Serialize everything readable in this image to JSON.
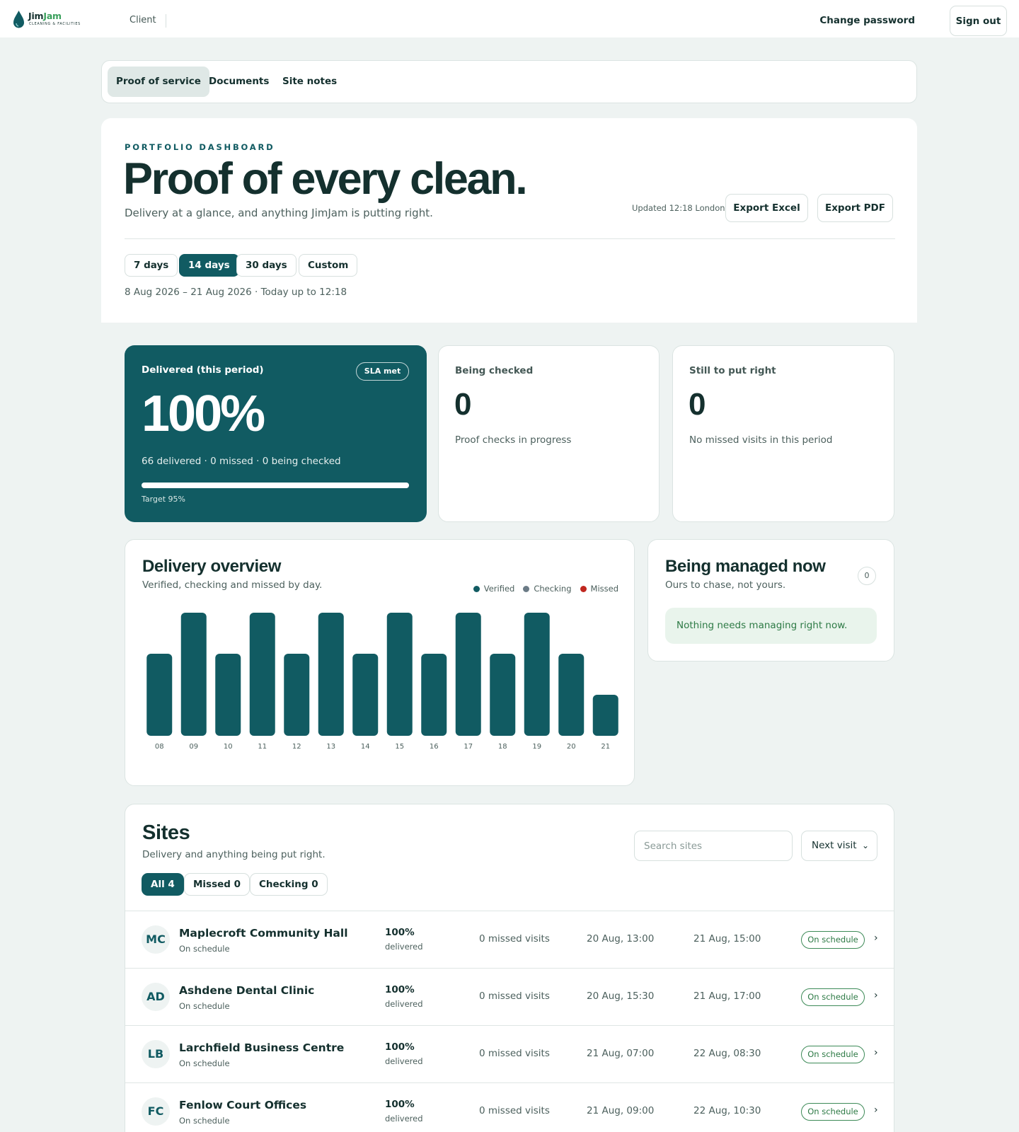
{
  "brand": {
    "name_a": "Jim",
    "name_b": "Jam",
    "tagline": "CLEANING & FACILITIES",
    "accent": "#115b62",
    "brand_green": "#3aa05c",
    "drop_icon": "water-drop-icon"
  },
  "topbar": {
    "section": "Client",
    "change_password": "Change password",
    "sign_out": "Sign out"
  },
  "tabs": [
    {
      "label": "Proof of service",
      "active": true
    },
    {
      "label": "Documents",
      "active": false
    },
    {
      "label": "Site notes",
      "active": false
    }
  ],
  "hero": {
    "eyebrow": "PORTFOLIO DASHBOARD",
    "title": "Proof of every clean.",
    "subtitle": "Delivery at a glance, and anything JimJam is putting right.",
    "updated": "Updated 12:18 London",
    "export_excel": "Export Excel",
    "export_pdf": "Export PDF",
    "periods": [
      "7 days",
      "14 days",
      "30 days",
      "Custom"
    ],
    "active_period": "14 days",
    "range": "8 Aug 2026 – 21 Aug 2026 · Today up to 12:18"
  },
  "kpis": {
    "delivered": {
      "label": "Delivered (this period)",
      "badge": "SLA met",
      "value": "100%",
      "sub": "66 delivered · 0 missed · 0 being checked",
      "target": "Target 95%",
      "progress": 1.0
    },
    "checking": {
      "label": "Being checked",
      "value": "0",
      "sub": "Proof checks in progress"
    },
    "put_right": {
      "label": "Still to put right",
      "value": "0",
      "sub": "No missed visits in this period"
    }
  },
  "overview": {
    "title": "Delivery overview",
    "subtitle": "Verified, checking and missed by day.",
    "legend": [
      {
        "label": "Verified",
        "color": "#115b62"
      },
      {
        "label": "Checking",
        "color": "#6b7b86"
      },
      {
        "label": "Missed",
        "color": "#c0271f"
      }
    ]
  },
  "chart_data": {
    "type": "bar",
    "categories": [
      "08",
      "09",
      "10",
      "11",
      "12",
      "13",
      "14",
      "15",
      "16",
      "17",
      "18",
      "19",
      "20",
      "21"
    ],
    "series": [
      {
        "name": "Verified",
        "values": [
          4,
          6,
          4,
          6,
          4,
          6,
          4,
          6,
          4,
          6,
          4,
          6,
          4,
          2
        ]
      },
      {
        "name": "Checking",
        "values": [
          0,
          0,
          0,
          0,
          0,
          0,
          0,
          0,
          0,
          0,
          0,
          0,
          0,
          0
        ]
      },
      {
        "name": "Missed",
        "values": [
          0,
          0,
          0,
          0,
          0,
          0,
          0,
          0,
          0,
          0,
          0,
          0,
          0,
          0
        ]
      }
    ],
    "ylim": [
      0,
      6
    ],
    "grid": false,
    "legend_position": "top-right"
  },
  "managed": {
    "title": "Being managed now",
    "subtitle": "Ours to chase, not yours.",
    "count": "0",
    "empty": "Nothing needs managing right now."
  },
  "sites": {
    "title": "Sites",
    "subtitle": "Delivery and anything being put right.",
    "search_placeholder": "Search sites",
    "sort": "Next visit",
    "filters": [
      {
        "label": "All 4",
        "active": true
      },
      {
        "label": "Missed 0",
        "active": false
      },
      {
        "label": "Checking 0",
        "active": false
      }
    ],
    "rows": [
      {
        "initials": "MC",
        "name": "Maplecroft Community Hall",
        "status": "On schedule",
        "pct": "100%",
        "pct_label": "delivered",
        "missed": "0 missed visits",
        "last": "20 Aug, 13:00",
        "next": "21 Aug, 15:00",
        "badge": "On schedule"
      },
      {
        "initials": "AD",
        "name": "Ashdene Dental Clinic",
        "status": "On schedule",
        "pct": "100%",
        "pct_label": "delivered",
        "missed": "0 missed visits",
        "last": "20 Aug, 15:30",
        "next": "21 Aug, 17:00",
        "badge": "On schedule"
      },
      {
        "initials": "LB",
        "name": "Larchfield Business Centre",
        "status": "On schedule",
        "pct": "100%",
        "pct_label": "delivered",
        "missed": "0 missed visits",
        "last": "21 Aug, 07:00",
        "next": "22 Aug, 08:30",
        "badge": "On schedule"
      },
      {
        "initials": "FC",
        "name": "Fenlow Court Offices",
        "status": "On schedule",
        "pct": "100%",
        "pct_label": "delivered",
        "missed": "0 missed visits",
        "last": "21 Aug, 09:00",
        "next": "22 Aug, 10:30",
        "badge": "On schedule"
      }
    ]
  }
}
